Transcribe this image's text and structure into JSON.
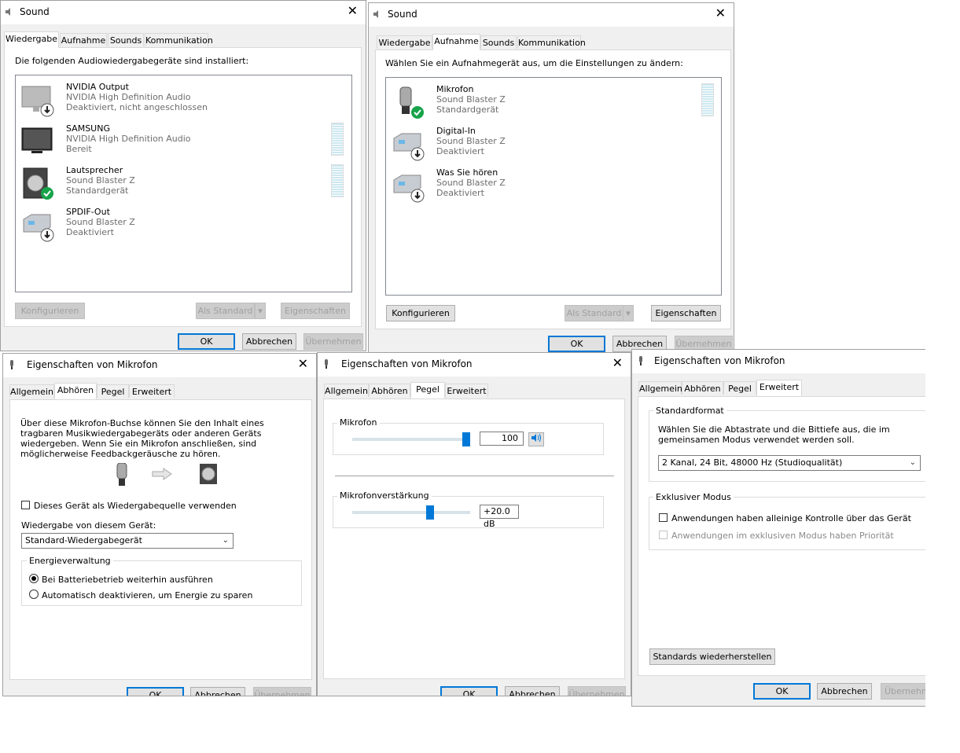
{
  "sound1": {
    "title": "Sound",
    "tabs": [
      "Wiedergabe",
      "Aufnahme",
      "Sounds",
      "Kommunikation"
    ],
    "intro": "Die folgenden Audiowiedergabegeräte sind installiert:",
    "devices": [
      {
        "name": "NVIDIA Output",
        "driver": "NVIDIA High Definition Audio",
        "status": "Deaktiviert, nicht angeschlossen",
        "icon": "monitor-disabled-icon"
      },
      {
        "name": "SAMSUNG",
        "driver": "NVIDIA High Definition Audio",
        "status": "Bereit",
        "icon": "tv-icon"
      },
      {
        "name": "Lautsprecher",
        "driver": "Sound Blaster Z",
        "status": "Standardgerät",
        "icon": "speaker-default-icon"
      },
      {
        "name": "SPDIF-Out",
        "driver": "Sound Blaster Z",
        "status": "Deaktiviert",
        "icon": "digital-out-disabled-icon"
      }
    ],
    "buttons": {
      "configure": "Konfigurieren",
      "set_default": "Als Standard",
      "properties": "Eigenschaften",
      "ok": "OK",
      "cancel": "Abbrechen",
      "apply": "Übernehmen"
    }
  },
  "sound2": {
    "title": "Sound",
    "tabs": [
      "Wiedergabe",
      "Aufnahme",
      "Sounds",
      "Kommunikation"
    ],
    "intro": "Wählen Sie ein Aufnahmegerät aus, um die Einstellungen zu ändern:",
    "devices": [
      {
        "name": "Mikrofon",
        "driver": "Sound Blaster Z",
        "status": "Standardgerät",
        "icon": "microphone-default-icon"
      },
      {
        "name": "Digital-In",
        "driver": "Sound Blaster Z",
        "status": "Deaktiviert",
        "icon": "digital-in-disabled-icon"
      },
      {
        "name": "Was Sie hören",
        "driver": "Sound Blaster Z",
        "status": "Deaktiviert",
        "icon": "what-u-hear-disabled-icon"
      }
    ],
    "buttons": {
      "configure": "Konfigurieren",
      "set_default": "Als Standard",
      "properties": "Eigenschaften",
      "ok": "OK",
      "cancel": "Abbrechen",
      "apply": "Übernehmen"
    }
  },
  "mic_listen": {
    "title": "Eigenschaften von Mikrofon",
    "tabs": [
      "Allgemein",
      "Abhören",
      "Pegel",
      "Erweitert"
    ],
    "description": "Über diese Mikrofon-Buchse können Sie den Inhalt eines tragbaren Musikwiedergabegeräts oder anderen Geräts wiedergeben. Wenn Sie ein Mikrofon anschließen, sind möglicherweise Feedbackgeräusche zu hören.",
    "listen_checkbox": "Dieses Gerät als Wiedergabequelle verwenden",
    "playback_label": "Wiedergabe von diesem Gerät:",
    "playback_value": "Standard-Wiedergabegerät",
    "power_group": "Energieverwaltung",
    "power_option_1": "Bei Batteriebetrieb weiterhin ausführen",
    "power_option_2": "Automatisch deaktivieren, um Energie zu sparen",
    "buttons": {
      "ok": "OK",
      "cancel": "Abbrechen",
      "apply": "Übernehmen"
    }
  },
  "mic_levels": {
    "title": "Eigenschaften von Mikrofon",
    "tabs": [
      "Allgemein",
      "Abhören",
      "Pegel",
      "Erweitert"
    ],
    "mic_label": "Mikrofon",
    "mic_value": "100",
    "mic_level": 1.0,
    "boost_label": "Mikrofonverstärkung",
    "boost_value": "+20.0 dB",
    "boost_level": 0.67,
    "buttons": {
      "ok": "OK",
      "cancel": "Abbrechen",
      "apply": "Übernehmen"
    }
  },
  "mic_advanced": {
    "title": "Eigenschaften von Mikrofon",
    "tabs": [
      "Allgemein",
      "Abhören",
      "Pegel",
      "Erweitert"
    ],
    "format_group": "Standardformat",
    "format_desc": "Wählen Sie die Abtastrate und die Bittiefe aus, die im gemeinsamen Modus verwendet werden soll.",
    "format_value": "2 Kanal, 24 Bit, 48000 Hz (Studioqualität)",
    "exclusive_group": "Exklusiver Modus",
    "exclusive_opt_1": "Anwendungen haben alleinige Kontrolle über das Gerät",
    "exclusive_opt_2": "Anwendungen im exklusiven Modus haben Priorität",
    "restore_button": "Standards wiederherstellen",
    "buttons": {
      "ok": "OK",
      "cancel": "Abbrechen",
      "apply": "Übernehmen"
    }
  },
  "colors": {
    "accent": "#0078d7",
    "success": "#16a34a"
  }
}
